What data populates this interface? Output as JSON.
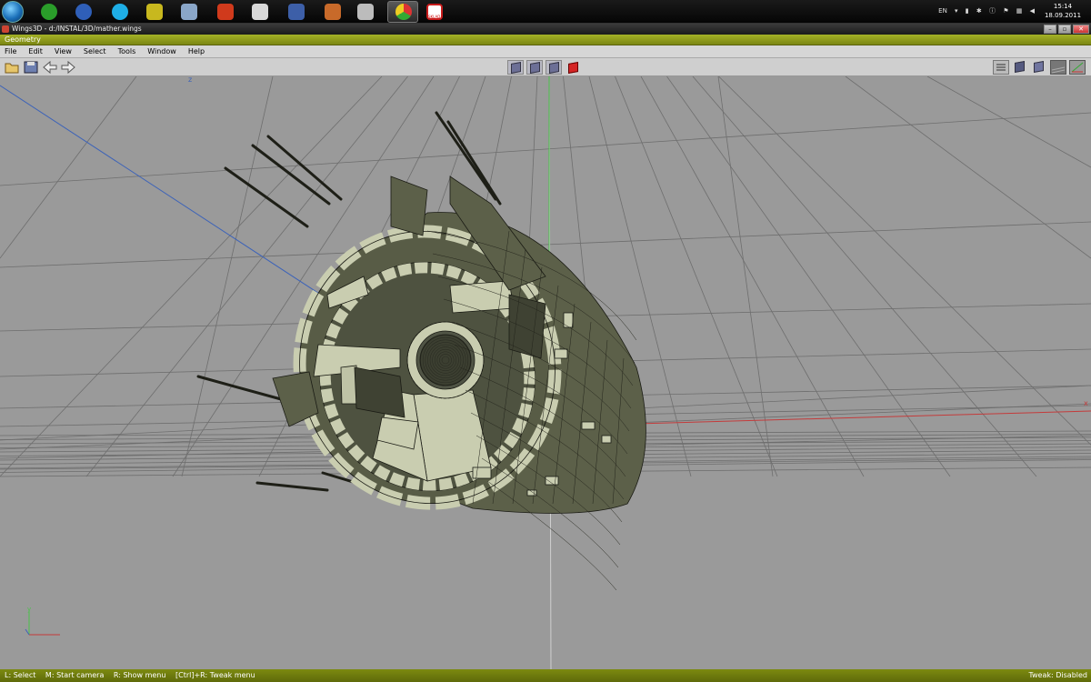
{
  "taskbar": {
    "apps": [
      {
        "name": "utorrent",
        "color": "#2a9d2a"
      },
      {
        "name": "google-earth",
        "color": "#2f5fb8"
      },
      {
        "name": "skype",
        "color": "#1eaee6"
      },
      {
        "name": "puzzle",
        "color": "#c8b81e"
      },
      {
        "name": "pencil-tool",
        "color": "#8aa6c8"
      },
      {
        "name": "ccleaner",
        "color": "#d03a1c"
      },
      {
        "name": "speaker",
        "color": "#d8d8d8"
      },
      {
        "name": "floppy-save",
        "color": "#3d5fa8"
      },
      {
        "name": "rocket",
        "color": "#c86a2a"
      },
      {
        "name": "alien-skull",
        "color": "#bcbcbc"
      },
      {
        "name": "chrome",
        "color": "#e0c21c"
      },
      {
        "name": "wings3d",
        "color": "#c81c1c"
      }
    ],
    "wings_icon_text": "SKLAD",
    "tray_lang": "EN",
    "clock_time": "15:14",
    "clock_date": "18.09.2011"
  },
  "window": {
    "title": "Wings3D - d:/INSTAL/3D/mather.wings"
  },
  "geometry_header": "Geometry",
  "menu": [
    "File",
    "Edit",
    "View",
    "Select",
    "Tools",
    "Window",
    "Help"
  ],
  "viewport": {
    "axis_label_z": "z",
    "axis_label_x": "x",
    "mini_axis_y": "y"
  },
  "status": {
    "hints": [
      "L: Select",
      "M: Start camera",
      "R: Show menu",
      "[Ctrl]+R: Tweak menu"
    ],
    "tweak": "Tweak: Disabled"
  },
  "colors": {
    "header_green": "#8d9a1c",
    "viewport_bg": "#9a9a9a",
    "mesh_dark": "#5e6149",
    "mesh_light": "#c9cdb0"
  }
}
